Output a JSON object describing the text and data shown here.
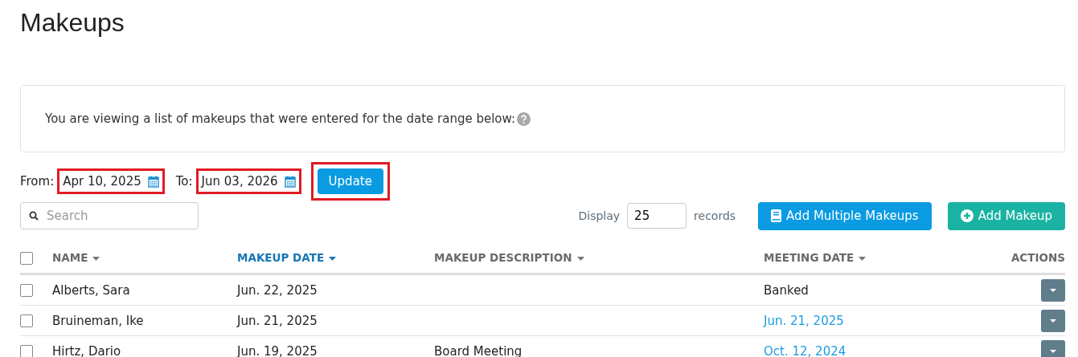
{
  "title": "Makeups",
  "info": {
    "text": "You are viewing a list of makeups that were entered for the date range below:"
  },
  "filter": {
    "from_label": "From:",
    "from": "Apr 10, 2025",
    "to_label": "To:",
    "to": "Jun 03, 2026",
    "update": "Update"
  },
  "search": {
    "placeholder": "Search"
  },
  "display": {
    "label": "Display",
    "value": "25",
    "suffix": "records"
  },
  "buttons": [
    {
      "label": "Add Multiple Makeups",
      "kind": "book"
    },
    {
      "label": "Add Makeup",
      "kind": "plus"
    }
  ],
  "table": {
    "select_all": {
      "checked": false
    },
    "columns": [
      {
        "label": "NAME",
        "sortable": true,
        "sorted": false
      },
      {
        "label": "MAKEUP DATE",
        "sortable": true,
        "sorted": true
      },
      {
        "label": "MAKEUP DESCRIPTION",
        "sortable": true,
        "sorted": false
      },
      {
        "label": "MEETING DATE",
        "sortable": true,
        "sorted": false
      },
      {
        "label": "ACTIONS",
        "sortable": false,
        "sorted": false
      }
    ],
    "rows": [
      {
        "checked": false,
        "name": "Alberts, Sara",
        "makeup_date": "Jun. 22, 2025",
        "meeting_date": "Banked",
        "kind": "text"
      },
      {
        "checked": false,
        "name": "Bruineman, Ike",
        "makeup_date": "Jun. 21, 2025",
        "meeting_date": "Jun. 21, 2025",
        "kind": "link"
      },
      {
        "checked": false,
        "name": "Hirtz, Dario",
        "makeup_date": "Jun. 19, 2025",
        "description": "Board Meeting",
        "meeting_date": "Oct. 12, 2024",
        "kind": "link"
      }
    ]
  }
}
